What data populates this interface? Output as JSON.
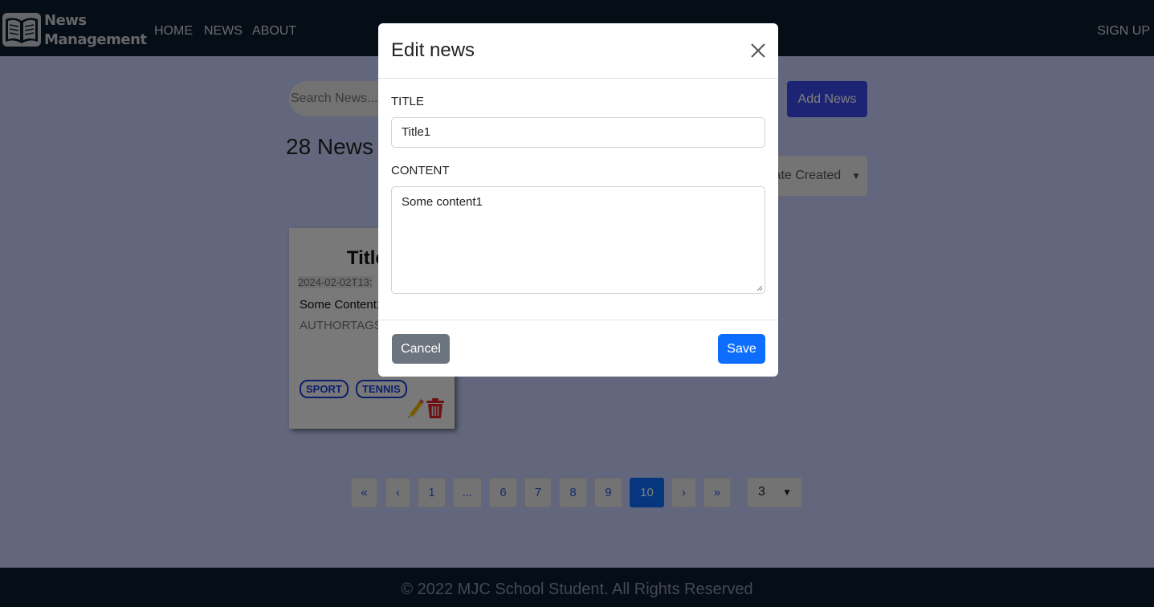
{
  "header": {
    "brand_line1": "News",
    "brand_line2": "Management",
    "nav": [
      "HOME",
      "NEWS",
      "ABOUT"
    ],
    "signup": "SIGN UP"
  },
  "toolbar": {
    "search_placeholder": "Search News...",
    "add_news": "Add News",
    "count": "28 News",
    "sort_value": "Date Created"
  },
  "card": {
    "title": "Title1",
    "date": "2024-02-02T13:",
    "content": "Some Content1",
    "author": "AUTHORTAGS",
    "tags": [
      "SPORT",
      "TENNIS"
    ]
  },
  "pagination": {
    "items": [
      "«",
      "‹",
      "1",
      "...",
      "6",
      "7",
      "8",
      "9",
      "10",
      "›",
      "»"
    ],
    "active": "10",
    "page_size": "3"
  },
  "footer": {
    "text": "© 2022 MJC School Student. All Rights Reserved"
  },
  "modal": {
    "title": "Edit news",
    "title_label": "TITLE",
    "title_value": "Title1",
    "content_label": "CONTENT",
    "content_value": "Some content1",
    "cancel": "Cancel",
    "save": "Save"
  },
  "colors": {
    "header_bg": "#0b1a2c",
    "accent": "#0d6efd",
    "add_news_bg": "#3a49e6",
    "tag": "#1a3fd6",
    "cancel_bg": "#6c757d"
  }
}
